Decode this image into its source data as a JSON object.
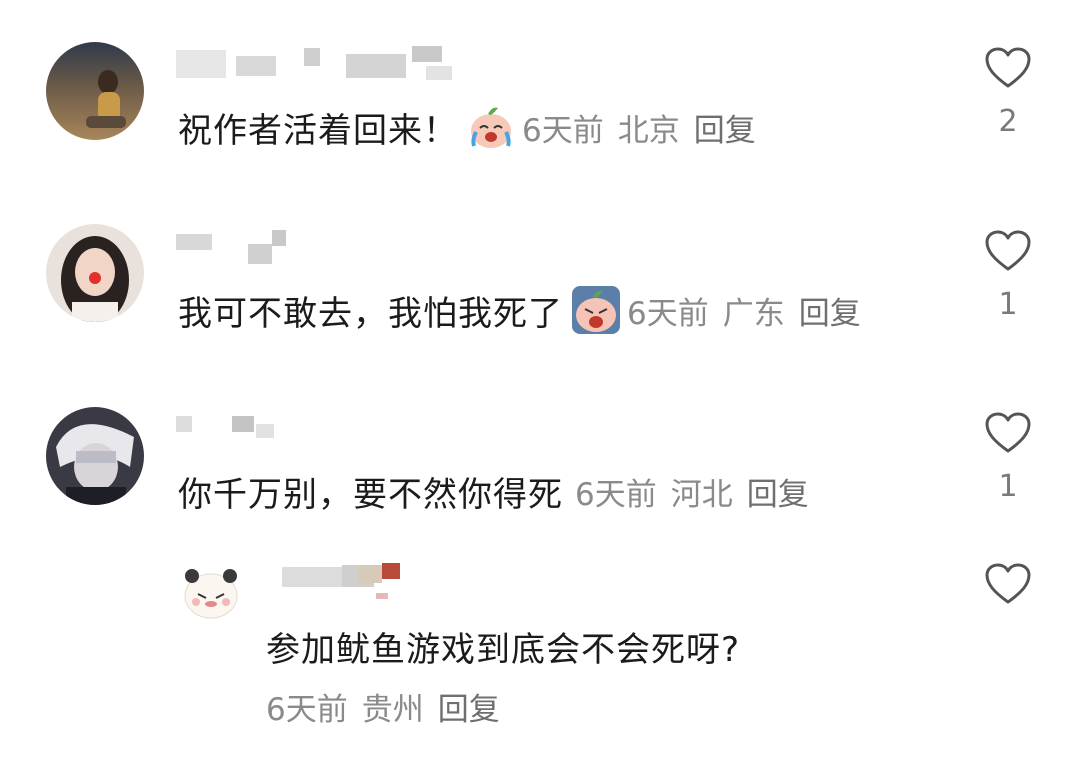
{
  "comments": [
    {
      "text": "祝作者活着回来！",
      "emoji": "crying-peach-emoji",
      "time": "6天前",
      "location": "北京",
      "reply_label": "回复",
      "likes": "2"
    },
    {
      "text": "我可不敢去，我怕我死了",
      "emoji": "scared-peach-emoji",
      "time": "6天前",
      "location": "广东",
      "reply_label": "回复",
      "likes": "1"
    },
    {
      "text": "你千万别，要不然你得死",
      "time": "6天前",
      "location": "河北",
      "reply_label": "回复",
      "likes": "1"
    }
  ],
  "reply": {
    "text": "参加鱿鱼游戏到底会不会死呀?",
    "time": "6天前",
    "location": "贵州",
    "reply_label": "回复",
    "likes": ""
  },
  "icons": {
    "like": "heart-outline-icon"
  },
  "colors": {
    "text": "#1b1b1b",
    "meta": "#8a8a8a",
    "heart_stroke": "#555555"
  }
}
